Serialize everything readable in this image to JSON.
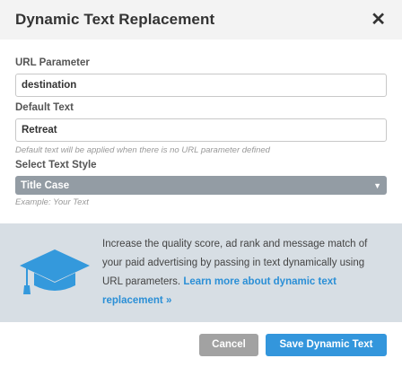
{
  "dialog": {
    "title": "Dynamic Text Replacement",
    "close_icon": "close-icon"
  },
  "form": {
    "url_param_label": "URL Parameter",
    "url_param_value": "destination",
    "default_text_label": "Default Text",
    "default_text_value": "Retreat",
    "default_text_hint": "Default text will be applied when there is no URL parameter defined",
    "text_style_label": "Select Text Style",
    "text_style_value": "Title Case",
    "text_style_example": "Example: Your Text"
  },
  "info": {
    "icon": "graduation-cap-icon",
    "text": "Increase the quality score, ad rank and message match of your paid advertising by passing in text dynamically using URL parameters. ",
    "link": "Learn more about dynamic text replacement »"
  },
  "footer": {
    "cancel_label": "Cancel",
    "save_label": "Save Dynamic Text"
  },
  "colors": {
    "accent": "#3396dc",
    "info_bg": "#d7dee4",
    "select_bg": "#939ca4",
    "cancel_bg": "#a2a2a2"
  }
}
